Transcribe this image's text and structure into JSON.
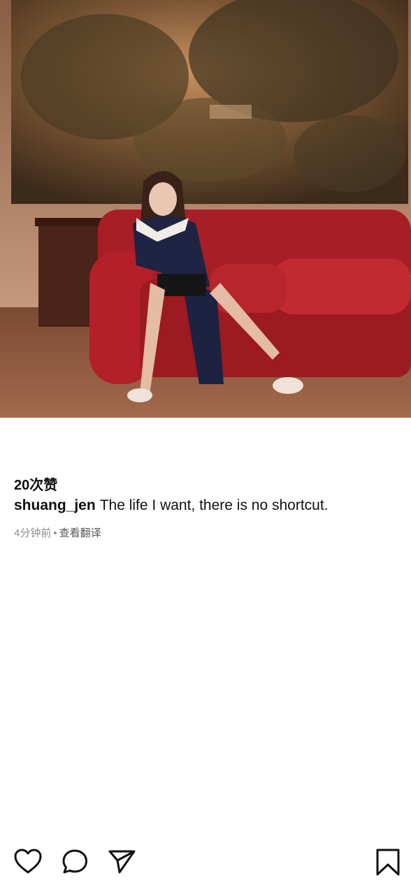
{
  "post": {
    "likes_label": "20次赞",
    "username": "shuang_jen",
    "caption_text": "The life I want, there is no shortcut.",
    "time_ago": "4分钟前",
    "separator": "•",
    "translate_label": "查看翻译"
  },
  "icons": {
    "like": "heart-icon",
    "comment": "comment-icon",
    "share": "send-icon",
    "save": "bookmark-icon"
  },
  "colors": {
    "sofa_red": "#b3202a",
    "tapestry_brown": "#6b4a2e",
    "meta_gray": "#8e8e8e"
  }
}
